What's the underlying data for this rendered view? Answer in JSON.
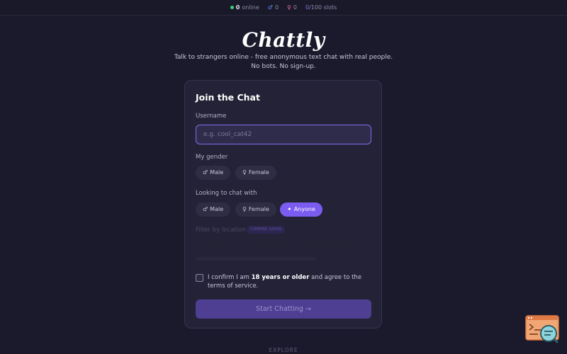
{
  "topbar": {
    "online_count": "0",
    "online_label": "online",
    "male_symbol": "♂",
    "male_count": "0",
    "female_symbol": "♀",
    "female_count": "0",
    "slots_used": "0",
    "slots_total": "/100 slots"
  },
  "brand": {
    "logo": "Chattly",
    "tagline_line1": "Talk to strangers online - free anonymous text chat with real people.",
    "tagline_line2": "No bots. No sign-up."
  },
  "form": {
    "title": "Join the Chat",
    "username_label": "Username",
    "username_placeholder": "e.g. cool_cat42",
    "username_value": "",
    "gender_label": "My gender",
    "gender_options": [
      {
        "symbol": "♂",
        "label": "Male"
      },
      {
        "symbol": "♀",
        "label": "Female"
      }
    ],
    "looking_label": "Looking to chat with",
    "looking_options": [
      {
        "symbol": "♂",
        "label": "Male"
      },
      {
        "symbol": "♀",
        "label": "Female"
      },
      {
        "symbol": "✦",
        "label": "Anyone"
      }
    ],
    "looking_selected": "Anyone",
    "location_label": "Filter by location",
    "location_badge": "COMING SOON",
    "confirm_prefix": "I confirm I am ",
    "confirm_bold": "18 years or older",
    "confirm_suffix": " and agree to the terms of service.",
    "confirm_checked": false,
    "start_button": "Start Chatting →"
  },
  "footer": {
    "explore": "EXPLORE"
  },
  "colors": {
    "background": "#1b1a2c",
    "card": "#232236",
    "accent": "#7b5cf0",
    "online_dot": "#3ecf7a",
    "male": "#6f8cff",
    "female": "#ff6b9d"
  },
  "icons": {
    "online": "online-dot-icon",
    "male": "male-icon",
    "female": "female-icon",
    "anyone": "sparkle-icon",
    "widget": "terminal-search-icon"
  }
}
